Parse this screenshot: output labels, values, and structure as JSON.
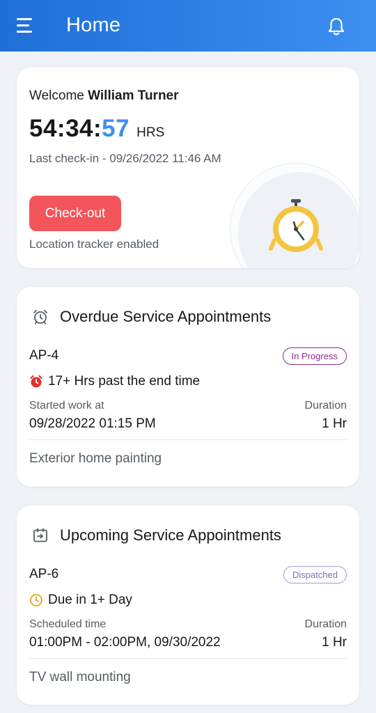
{
  "header": {
    "title": "Home",
    "menu_icon": "hamburger-menu-icon",
    "notification_icon": "bell-icon"
  },
  "welcome_card": {
    "greeting": "Welcome",
    "user_name": "William Turner",
    "timer_hm": "54:34:",
    "timer_seconds": "57",
    "timer_unit": "HRS",
    "last_checkin": "Last check-in - 09/26/2022 11:46 AM",
    "checkout_label": "Check-out",
    "tracker_status": "Location tracker enabled",
    "accent_color": "#3d8ff0",
    "checkout_color": "#f2555a"
  },
  "overdue": {
    "title": "Overdue Service Appointments",
    "appointment": {
      "id": "AP-4",
      "status": "In Progress",
      "overdue_text": "17+ Hrs past the end time",
      "time_label": "Started work at",
      "time_value": "09/28/2022 01:15 PM",
      "duration_label": "Duration",
      "duration_value": "1 Hr",
      "description": "Exterior home painting"
    }
  },
  "upcoming": {
    "title": "Upcoming Service Appointments",
    "appointment": {
      "id": "AP-6",
      "status": "Dispatched",
      "due_text": "Due in 1+ Day",
      "time_label": "Scheduled time",
      "time_value": "01:00PM - 02:00PM, 09/30/2022",
      "duration_label": "Duration",
      "duration_value": "1 Hr",
      "description": "TV wall mounting"
    }
  }
}
